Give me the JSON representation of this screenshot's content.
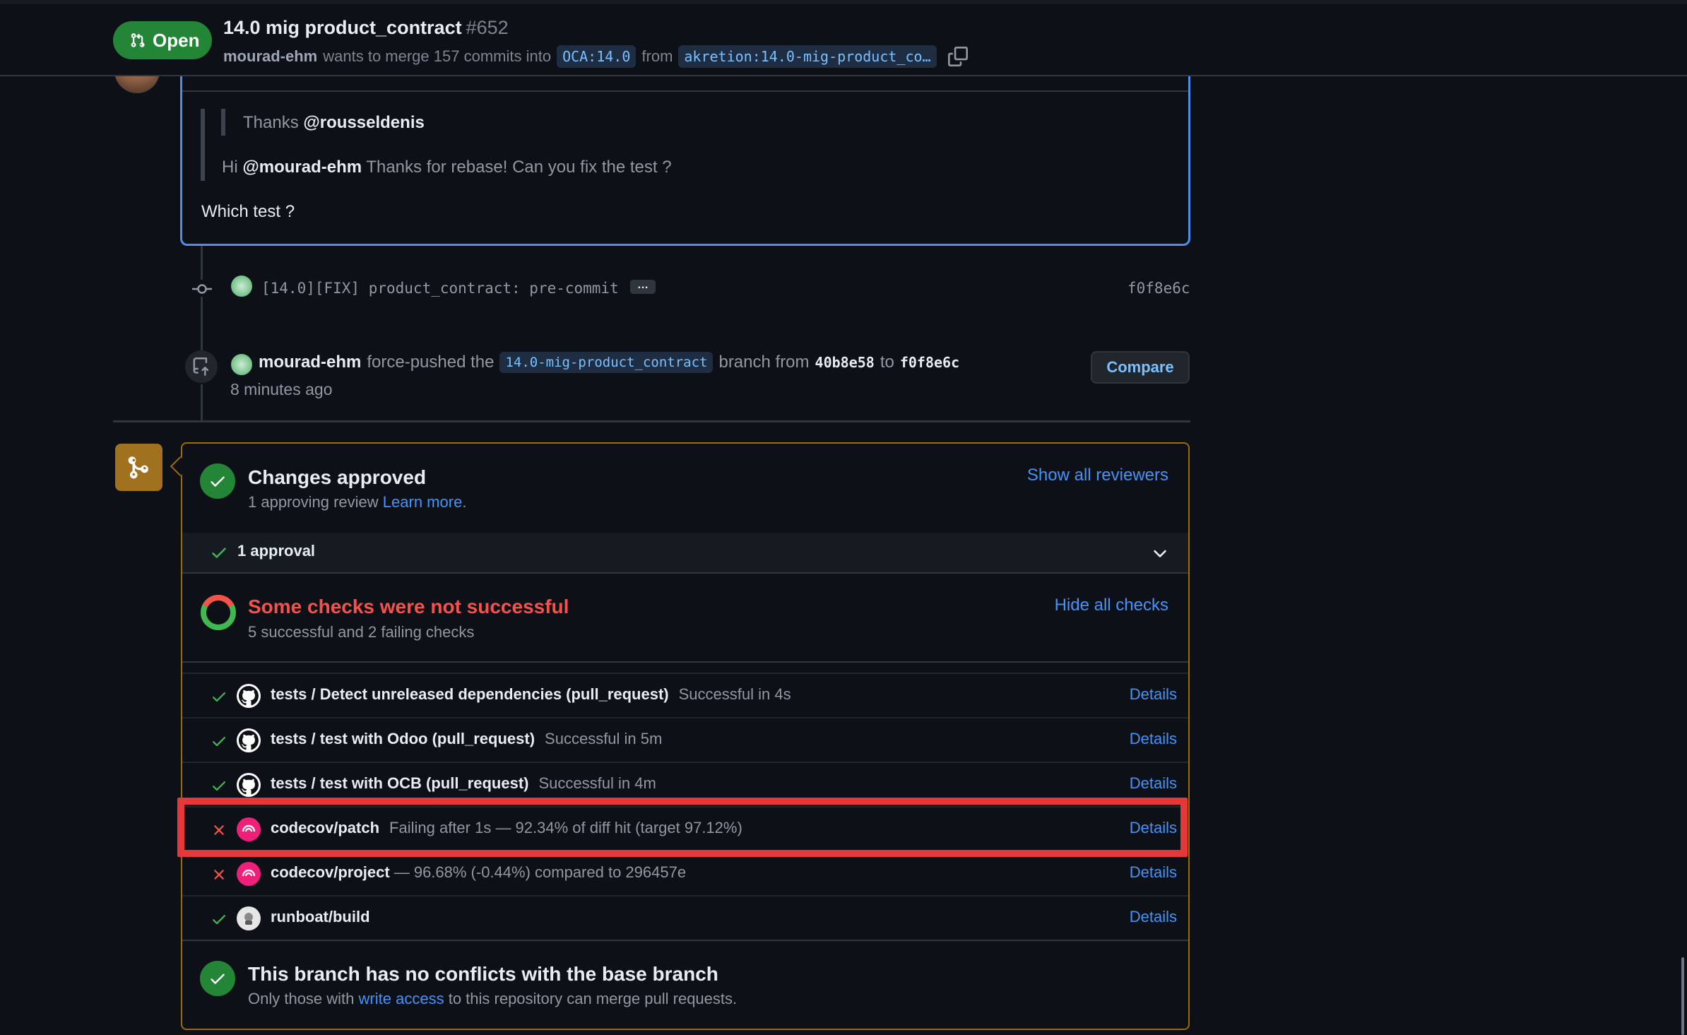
{
  "header": {
    "state_label": "Open",
    "title": "14.0 mig product_contract",
    "number": "#652",
    "author": "mourad-ehm",
    "merge_text": "wants to merge 157 commits into",
    "base_branch": "OCA:14.0",
    "from_text": "from",
    "head_branch": "akretion:14.0-mig-product_co…"
  },
  "comment": {
    "quote_inner_prefix": "Thanks",
    "quote_inner_mention": "@rousseldenis",
    "quote_prefix": "Hi",
    "quote_mention": "@mourad-ehm",
    "quote_text": "Thanks for rebase! Can you fix the test ?",
    "reply": "Which test ?"
  },
  "timeline": {
    "commit_message": "[14.0][FIX] product_contract: pre-commit",
    "commit_ellipsis": "…",
    "commit_sha": "f0f8e6c",
    "push_author": "mourad-ehm",
    "push_verb": "force-pushed the",
    "push_branch": "14.0-mig-product_contract",
    "push_from": "branch from",
    "push_old_sha": "40b8e58",
    "push_to": "to",
    "push_new_sha": "f0f8e6c",
    "push_time": "8 minutes ago",
    "compare_label": "Compare"
  },
  "merge_box": {
    "approved_title": "Changes approved",
    "approved_sub": "1 approving review",
    "learn_more": "Learn more",
    "show_reviewers": "Show all reviewers",
    "approval_count": "1 approval",
    "checks_title": "Some checks were not successful",
    "checks_sub": "5 successful and 2 failing checks",
    "hide_checks": "Hide all checks",
    "checks": [
      {
        "name": "tests / Detect unreleased dependencies (pull_request)",
        "desc": "Successful in 4s",
        "status": "success",
        "app": "github",
        "details": "Details"
      },
      {
        "name": "tests / test with Odoo (pull_request)",
        "desc": "Successful in 5m",
        "status": "success",
        "app": "github",
        "details": "Details"
      },
      {
        "name": "tests / test with OCB (pull_request)",
        "desc": "Successful in 4m",
        "status": "success",
        "app": "github",
        "details": "Details"
      },
      {
        "name": "codecov/patch",
        "desc": "Failing after 1s — 92.34% of diff hit (target 97.12%)",
        "status": "failure",
        "app": "codecov",
        "details": "Details"
      },
      {
        "name": "codecov/project",
        "desc": "— 96.68% (-0.44%) compared to 296457e",
        "status": "failure",
        "app": "codecov",
        "details": "Details"
      },
      {
        "name": "runboat/build",
        "desc": "",
        "status": "success",
        "app": "runboat",
        "details": "Details"
      }
    ],
    "conflict_title": "This branch has no conflicts with the base branch",
    "conflict_sub_prefix": "Only those with",
    "conflict_sub_link": "write access",
    "conflict_sub_suffix": "to this repository can merge pull requests."
  },
  "colors": {
    "success": "#3fb950",
    "failure": "#f85149",
    "accent": "#4493f8",
    "highlight": "#e5383b",
    "merge_border": "#9e6a03"
  }
}
